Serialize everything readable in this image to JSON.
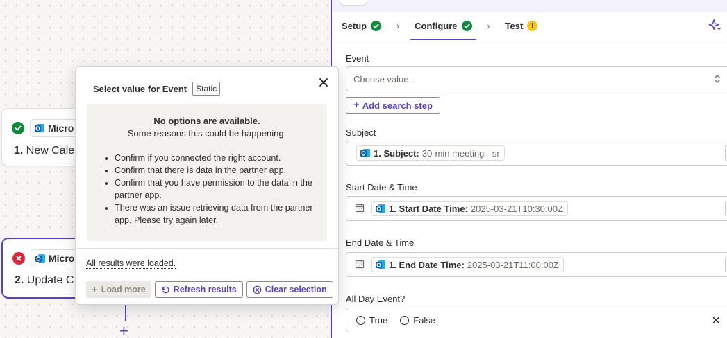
{
  "canvas": {
    "steps": [
      {
        "status": "success",
        "app_name": "Micro",
        "number": "1.",
        "title": "New Caler"
      },
      {
        "status": "error",
        "app_name": "Micro",
        "number": "2.",
        "title": "Update C"
      }
    ],
    "add_icon": "plus-icon"
  },
  "panel": {
    "tabs": [
      {
        "label": "Setup",
        "status": "complete"
      },
      {
        "label": "Configure",
        "status": "complete",
        "active": true
      },
      {
        "label": "Test",
        "status": "warning"
      }
    ],
    "warn_glyph": "!",
    "event": {
      "label": "Event",
      "placeholder": "Choose value..."
    },
    "add_search_step": "Add search step",
    "subject": {
      "label": "Subject",
      "pill_key": "1. Subject:",
      "pill_value": "30-min meeting - sr"
    },
    "start": {
      "label": "Start Date & Time",
      "pill_key": "1. Start Date Time:",
      "pill_value": "2025-03-21T10:30:00Z"
    },
    "end": {
      "label": "End Date & Time",
      "pill_key": "1. End Date Time:",
      "pill_value": "2025-03-21T11:00:00Z"
    },
    "all_day": {
      "label": "All Day Event?",
      "option_true": "True",
      "option_false": "False"
    }
  },
  "popover": {
    "title": "Select value for Event",
    "badge": "Static",
    "heading": "No options are available.",
    "subheading": "Some reasons this could be happening:",
    "reasons": [
      "Confirm if you connected the right account.",
      "Confirm that there is data in the partner app.",
      "Confirm that you have permission to the data in the partner app.",
      "There was an issue retrieving data from the partner app. Please try again later."
    ],
    "loaded_text": "All results were loaded.",
    "load_more": "Load more",
    "refresh": "Refresh results",
    "clear": "Clear selection"
  },
  "colors": {
    "accent": "#5a3fc7",
    "success": "#0f8a3c",
    "error": "#d4283c",
    "warning": "#f5c518",
    "outlook_blue": "#0a64ad"
  }
}
